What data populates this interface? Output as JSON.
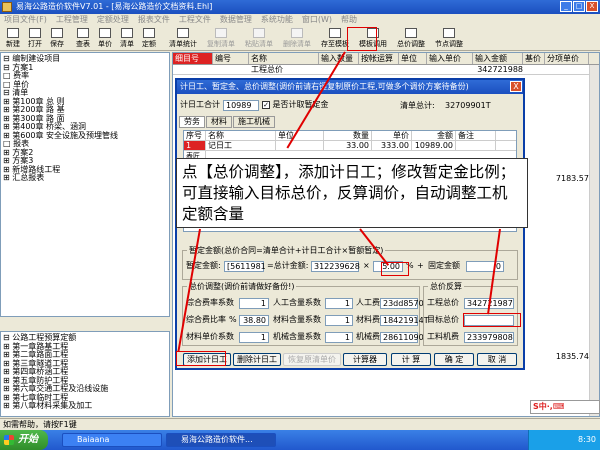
{
  "app": {
    "title": "易海公路造价软件V7.01 - [易海公路造价文档资料.Ehl]",
    "window_controls": [
      "_",
      "□",
      "X"
    ]
  },
  "menu": [
    "项目文件(F)",
    "工程管理",
    "定额处理",
    "报表文件",
    "工程文件",
    "数据管理",
    "系统功能",
    "窗口(W)",
    "帮助"
  ],
  "toolbar": [
    {
      "label": "新建",
      "dim": false
    },
    {
      "label": "打开",
      "dim": false
    },
    {
      "label": "保存",
      "dim": false
    },
    {
      "label": "查表",
      "dim": false
    },
    {
      "label": "单价",
      "dim": false
    },
    {
      "label": "清单",
      "dim": false
    },
    {
      "label": "定额",
      "dim": false
    },
    {
      "label": "清单统计",
      "dim": false
    },
    {
      "label": "复制清单",
      "dim": true
    },
    {
      "label": "粘贴清单",
      "dim": true
    },
    {
      "label": "删除清单",
      "dim": true
    },
    {
      "label": "存至模板",
      "dim": false
    },
    {
      "label": "模板调用",
      "dim": false
    },
    {
      "label": "总价调整",
      "dim": false
    },
    {
      "label": "节点调整",
      "dim": false
    }
  ],
  "tree": {
    "items": [
      "⊟ 编制建设项目",
      "  ⊟ 方案1",
      "     □ 费率",
      "     □ 单价",
      "     ⊟ 清单",
      "       ⊞ 第100章   总    则",
      "       ⊞ 第200章   路    基",
      "       ⊞ 第300章   路    面",
      "       ⊞ 第400章   桥梁、涵洞",
      "       ⊞ 第600章   安全设施及预埋管线",
      "     □ 报表",
      "  ⊞ 方案2",
      "  ⊞ 方案3",
      "  ⊞ 新增路线工程",
      "  ⊞ 汇总报表"
    ]
  },
  "tree2": {
    "items": [
      "⊟ 公路工程预算定额",
      "  ⊞ 第一章路基工程",
      "  ⊞ 第二章路面工程",
      "  ⊞ 第三章隧道工程",
      "  ⊞ 第四章桥涵工程",
      "  ⊞ 第五章防护工程",
      "  ⊞ 第六章交通工程及沿线设施",
      "  ⊞ 第七章临时工程",
      "  ⊞ 第八章材料采集及加工"
    ]
  },
  "grid": {
    "headers": [
      "细目号",
      "编号",
      "名称",
      "输入数量",
      "按帐运算",
      "单位",
      "输入单价",
      "输入金额",
      "基价",
      "分项单价"
    ],
    "first_row": {
      "name": "工程总价",
      "amount": "342721988"
    },
    "right_values": [
      "7183.57",
      "1835.74"
    ]
  },
  "dialog": {
    "title": "计日工、暂定金、总价调整(调价前请右键复制原价工程,可做多个调价方案待备份)",
    "close": "X",
    "label_rigong": "计日工合计",
    "rigong_total": "10989",
    "check_label": "是否计取暂定金",
    "label_bill_total": "清单总计:",
    "bill_total": "32709901T",
    "tabs": [
      "劳务",
      "材料",
      "施工机械"
    ],
    "table_headers": [
      "序号",
      "名称",
      "单位",
      "数量",
      "单价",
      "金额",
      "备注"
    ],
    "table_row": [
      "1",
      "记日工",
      "",
      "33.00",
      "333.00",
      "10989.00",
      ""
    ],
    "table_row2_label": "表匠",
    "zd_group": "暂定金额(总价合同=清单合计+计日工合计×暂额暂定)",
    "zd_label": "暂定金额:",
    "zd_value": "[5611981",
    "zd_formula": "=总计金额:",
    "zd_total": "312239628",
    "zd_x": "×",
    "zd_percent": "5.00",
    "zd_pct_sign": "%",
    "zd_plus": "+",
    "zd_fixed_label": "固定金额",
    "zd_fixed": "0",
    "adj_group": "总价调整(调价前请做好备份!)",
    "rows": [
      {
        "a_label": "综合费率系数",
        "a_val": "1",
        "b_label": "人工含量系数",
        "b_val": "1",
        "c_label": "人工费",
        "c_val": "23dd8570"
      },
      {
        "a_label": "综合费比率",
        "a_val": "38.80",
        "b_label": "材料含量系数",
        "b_val": "1",
        "c_label": "材料费",
        "c_val": "18421914T"
      },
      {
        "a_label": "材料单价系数",
        "a_val": "1",
        "b_label": "机械含量系数",
        "b_val": "1",
        "c_label": "机械费",
        "c_val": "28611090"
      }
    ],
    "a_pct_sign": "%",
    "rev_group": "总价反算",
    "rev_project_label": "工程总价",
    "rev_project_value": "342721987",
    "rev_target_label": "目标总价",
    "rev_target_value": "",
    "rev_machine_label": "工料机费",
    "rev_machine_value": "233979808",
    "buttons": [
      {
        "label": "添加计日工",
        "dim": false
      },
      {
        "label": "删除计日工",
        "dim": false
      },
      {
        "label": "恢复原清单价",
        "dim": true
      },
      {
        "label": "计算器",
        "dim": false
      },
      {
        "label": "计  算",
        "dim": false
      },
      {
        "label": "确  定",
        "dim": false
      },
      {
        "label": "取  消",
        "dim": false
      }
    ]
  },
  "annotation": "点【总价调整】，添加计日工；修改暂定金比例；可直接输入目标总价，反算调价，自动调整工机定额含量",
  "status": "如需帮助，请按F1键",
  "taskbar": {
    "start": "开始",
    "tasks": [
      "Baiaana",
      "易海公路造价软件..."
    ],
    "time": "8:30"
  },
  "ime": "S中·,⌨"
}
